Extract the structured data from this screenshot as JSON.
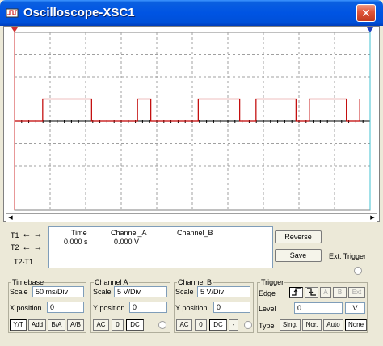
{
  "window": {
    "title": "Oscilloscope-XSC1"
  },
  "cursors": {
    "t1_label": "T1",
    "t2_label": "T2",
    "t2t1_label": "T2-T1",
    "col_time": "Time",
    "col_a": "Channel_A",
    "col_b": "Channel_B",
    "time_value": "0.000 s",
    "a_value": "0.000 V"
  },
  "buttons": {
    "reverse": "Reverse",
    "save": "Save",
    "ext_trigger": "Ext. Trigger"
  },
  "timebase": {
    "title": "Timebase",
    "scale_label": "Scale",
    "scale_value": "50 ms/Div",
    "xpos_label": "X position",
    "xpos_value": "0",
    "modes": [
      "Y/T",
      "Add",
      "B/A",
      "A/B"
    ]
  },
  "channel_a": {
    "title": "Channel A",
    "scale_label": "Scale",
    "scale_value": "5  V/Div",
    "ypos_label": "Y position",
    "ypos_value": "0",
    "coupling": [
      "AC",
      "0",
      "DC"
    ]
  },
  "channel_b": {
    "title": "Channel B",
    "scale_label": "Scale",
    "scale_value": "5  V/Div",
    "ypos_label": "Y position",
    "ypos_value": "0",
    "coupling": [
      "AC",
      "0",
      "DC",
      "-"
    ]
  },
  "trigger": {
    "title": "Trigger",
    "edge_label": "Edge",
    "edge_buttons": [
      "A",
      "B",
      "Ext"
    ],
    "level_label": "Level",
    "level_value": "0",
    "level_unit": "V",
    "type_label": "Type",
    "types": [
      "Sing.",
      "Nor.",
      "Auto",
      "None"
    ]
  },
  "colors": {
    "trace_a": "#c00000",
    "cursor_t1": "#d03030",
    "cursor_t2": "#40c0d0",
    "grid": "#a0a0a0"
  },
  "trace_a": {
    "low_volts": 0,
    "high_volts": 5,
    "volts_per_div": 5,
    "edges_divisions": [
      0.95,
      2.6,
      4.15,
      4.6,
      6.2,
      7.6,
      8.15,
      9.5,
      9.95,
      11.2,
      11.65
    ]
  }
}
